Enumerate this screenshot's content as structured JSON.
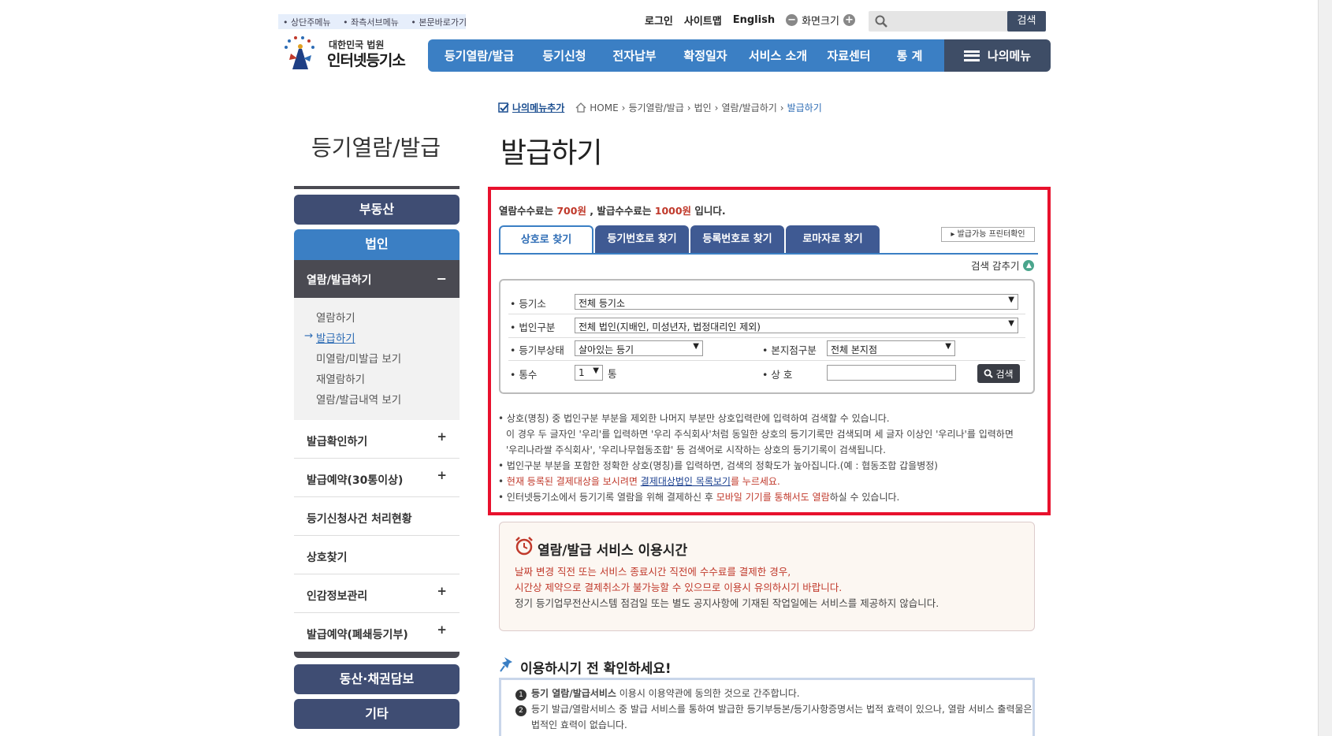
{
  "skip_links": [
    "상단주메뉴",
    "좌측서브메뉴",
    "본문바로가기"
  ],
  "util": {
    "login": "로그인",
    "sitemap": "사이트맵",
    "english": "English",
    "font_size": "화면크기",
    "minus": "−",
    "plus": "+"
  },
  "search": {
    "placeholder": "",
    "button": "검색"
  },
  "logo": {
    "line1": "대한민국 법원",
    "line2": "인터넷등기소"
  },
  "gnb": [
    "등기열람/발급",
    "등기신청",
    "전자납부",
    "확정일자",
    "서비스 소개",
    "자료센터",
    "통 계"
  ],
  "my_menu": "나의메뉴",
  "breadcrumb": {
    "add": "나의메뉴추가",
    "items": [
      "HOME",
      "등기열람/발급",
      "법인",
      "열람/발급하기"
    ],
    "current": "발급하기",
    "sep": "›"
  },
  "side_title": "등기열람/발급",
  "page_title": "발급하기",
  "sidebar": {
    "real_estate": "부동산",
    "corporation": "법인",
    "open_group": "열람/발급하기",
    "open_symbol": "−",
    "sub_items": [
      "열람하기",
      "발급하기",
      "미열람/미발급 보기",
      "재열람하기",
      "열람/발급내역 보기"
    ],
    "rows": [
      {
        "label": "발급확인하기",
        "plus": "+"
      },
      {
        "label": "발급예약(30통이상)",
        "plus": "+"
      },
      {
        "label": "등기신청사건 처리현황",
        "plus": ""
      },
      {
        "label": "상호찾기",
        "plus": ""
      },
      {
        "label": "인감정보관리",
        "plus": "+"
      },
      {
        "label": "발급예약(폐쇄등기부)",
        "plus": "+"
      }
    ],
    "movable": "동산·채권담보",
    "etc": "기타"
  },
  "fee": {
    "prefix": "열람수수료는 ",
    "view_fee": "700원",
    "mid": " , 발급수수료는 ",
    "issue_fee": "1000원",
    "suffix": " 입니다."
  },
  "tabs": [
    "상호로 찾기",
    "등기번호로 찾기",
    "등록번호로 찾기",
    "로마자로 찾기"
  ],
  "print_check": "▸ 발급가능 프린터확인",
  "hide_search": "검색 감추기",
  "form": {
    "registry_label": "등기소",
    "registry_value": "전체 등기소",
    "corp_type_label": "법인구분",
    "corp_type_value": "전체 법인(지배인, 미성년자, 법정대리인 제외)",
    "status_label": "등기부상태",
    "status_value": "살아있는 등기",
    "branch_label": "본지점구분",
    "branch_value": "전체 본지점",
    "copies_label": "통수",
    "copies_value": "1",
    "copies_unit": "통",
    "name_label": "상 호",
    "name_value": "",
    "search_button": "검색"
  },
  "notes": {
    "n1": "상호(명칭) 중 법인구분 부분을 제외한 나머지 부분만 상호입력란에 입력하여 검색할 수 있습니다.",
    "n1b": "이 경우 두 글자인 '우리'를 입력하면 '우리 주식회사'처럼 동일한 상호의 등기기록만 검색되며 세 글자 이상인 '우리나'를 입력하면",
    "n1c": "'우리나라쌀 주식회사', '우리나무협동조합' 등 검색어로 시작하는 상호의 등기기록이 검색됩니다.",
    "n2": "법인구분 부분을 포함한 정확한 상호(명칭)를 입력하면, 검색의 정확도가 높아집니다.(예 : 협동조합 갑을병정)",
    "n3a": "현재 등록된 결제대상을 보시려면 ",
    "n3link": "결제대상법인 목록보기",
    "n3b": "를 누르세요.",
    "n4a": "인터넷등기소에서 등기기록 열람을 위해 결제하신 후 ",
    "n4red": "모바일 기기를 통해서도 열람",
    "n4b": "하실 수 있습니다."
  },
  "service": {
    "title": "열람/발급 서비스 이용시간",
    "l1": "날짜 변경 직전 또는 서비스 종료시간 직전에 수수료를 결제한 경우,",
    "l2": "시간상 제약으로 결제취소가 불가능할 수 있으므로 이용시 유의하시기 바랍니다.",
    "l3": "정기 등기업무전산시스템 점검일 또는 별도 공지사항에 기재된 작업일에는 서비스를 제공하지 않습니다."
  },
  "check": {
    "title": "이용하시기 전 확인하세요!",
    "i1_num": "1",
    "i1_bold": "등기 열람/발급서비스",
    "i1": " 이용시 이용약관에 동의한 것으로 간주합니다.",
    "i2_num": "2",
    "i2": "등기 발급/열람서비스 중 발급 서비스를 통하여 발급한 등기부등본/등기사항증명서는 법적 효력이 있으나, 열람 서비스 출력물은",
    "i2b": "법적인 효력이 없습니다."
  }
}
